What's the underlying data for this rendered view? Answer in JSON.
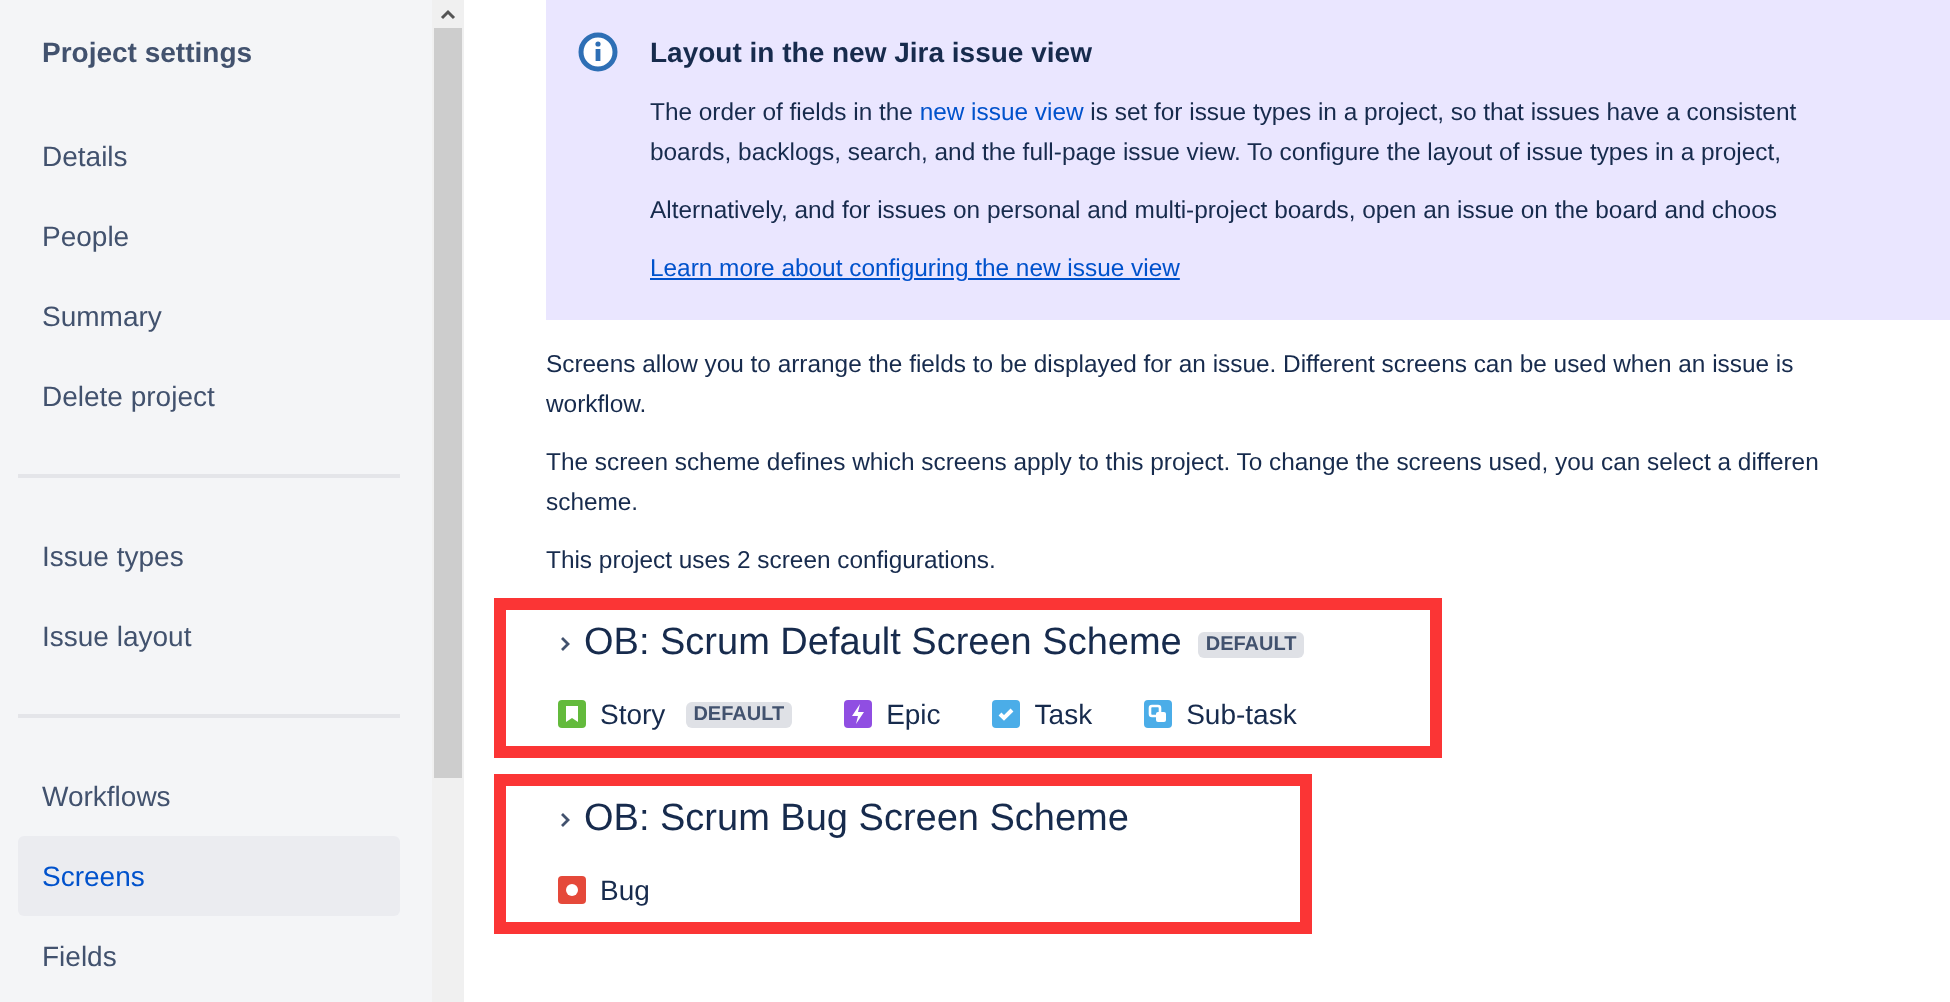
{
  "sidebar": {
    "title": "Project settings",
    "sections": [
      {
        "items": [
          {
            "label": "Details",
            "selected": false
          },
          {
            "label": "People",
            "selected": false
          },
          {
            "label": "Summary",
            "selected": false
          },
          {
            "label": "Delete project",
            "selected": false
          }
        ]
      },
      {
        "items": [
          {
            "label": "Issue types",
            "selected": false
          },
          {
            "label": "Issue layout",
            "selected": false
          }
        ]
      },
      {
        "items": [
          {
            "label": "Workflows",
            "selected": false
          },
          {
            "label": "Screens",
            "selected": true
          },
          {
            "label": "Fields",
            "selected": false
          }
        ]
      }
    ]
  },
  "banner": {
    "title": "Layout in the new Jira issue view",
    "paragraph_1": {
      "before": "The order of fields in the ",
      "link": "new issue view",
      "after": " is set for issue types in a project, so that issues have a consistent",
      "line_2": "boards, backlogs, search, and the full-page issue view. To configure the layout of issue types in a project,"
    },
    "paragraph_2": "Alternatively, and for issues on personal and multi-project boards, open an issue on the board and choos",
    "link": "Learn more about configuring the new issue view"
  },
  "paragraphs": [
    [
      "Screens allow you to arrange the fields to be displayed for an issue. Different screens can be used when an issue is",
      "workflow."
    ],
    [
      "The screen scheme defines which screens apply to this project. To change the screens used, you can select a differen",
      "scheme."
    ],
    [
      "This project uses 2 screen configurations."
    ]
  ],
  "schemes": [
    {
      "name": "OB: Scrum Default Screen Scheme",
      "badge": "DEFAULT",
      "highlighted": true,
      "issue_types": [
        {
          "kind": "story",
          "label": "Story",
          "badge": "DEFAULT"
        },
        {
          "kind": "epic",
          "label": "Epic"
        },
        {
          "kind": "task",
          "label": "Task"
        },
        {
          "kind": "subtask",
          "label": "Sub-task"
        }
      ]
    },
    {
      "name": "OB: Scrum Bug Screen Scheme",
      "highlighted": true,
      "issue_types": [
        {
          "kind": "bug",
          "label": "Bug"
        }
      ]
    }
  ]
}
